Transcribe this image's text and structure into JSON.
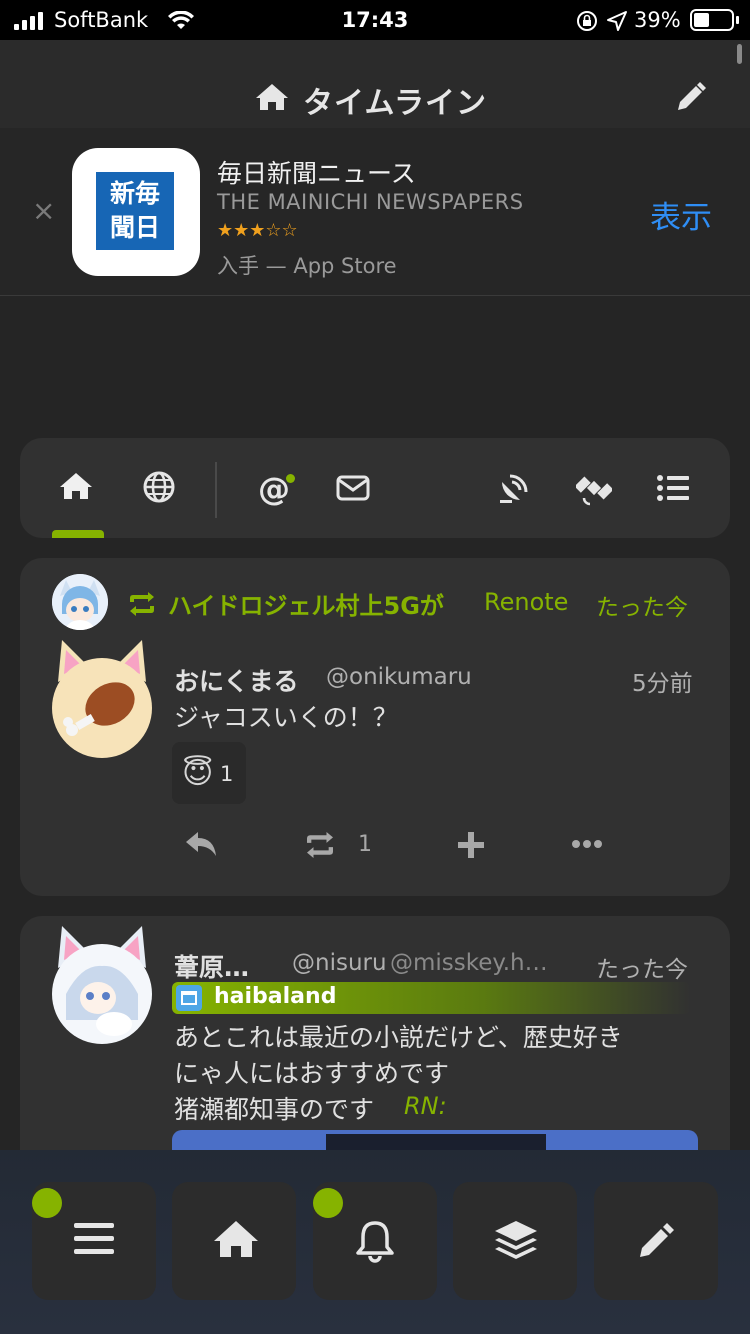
{
  "status_bar": {
    "carrier": "SoftBank",
    "time": "17:43",
    "battery": "39%"
  },
  "header": {
    "title": "タイムライン",
    "icon": "home-icon",
    "action_icon": "pencil-icon"
  },
  "app_banner": {
    "icon_text": "新毎\n聞日",
    "app_name": "毎日新聞ニュース",
    "publisher": "THE MAINICHI NEWSPAPERS",
    "rating": 3,
    "stars": "★★★☆☆",
    "source": "入手 — App Store",
    "view_label": "表示",
    "close_label": "×"
  },
  "timeline_tabs": [
    {
      "name": "home",
      "icon": "home-icon",
      "active": true
    },
    {
      "name": "global",
      "icon": "globe-icon"
    },
    {
      "name": "mentions",
      "icon": "at-icon",
      "has_indicator": true
    },
    {
      "name": "messages",
      "icon": "envelope-icon"
    },
    {
      "name": "antenna",
      "icon": "satellite-dish-icon"
    },
    {
      "name": "channels",
      "icon": "satellite-icon"
    },
    {
      "name": "lists",
      "icon": "list-icon"
    }
  ],
  "notes": [
    {
      "renote_by": "ハイドロジェル村上5Gが",
      "renote_label": "Renote",
      "renote_time": "たった今",
      "author": "おにくまる",
      "username": "@onikumaru",
      "time": "5分前",
      "text": "ジャコスいくの！？",
      "reaction_emoji": "😇",
      "reaction_count": "1",
      "renote_count": "1"
    },
    {
      "author": "葦原…",
      "username": "@nisuru",
      "host": "@misskey.h…",
      "time": "たった今",
      "instance": "haibaland",
      "text_lines": [
        "あとこれは最近の小説だけど、歴史好き",
        "にゃ人にはおすすめです",
        "猪瀬都知事のです"
      ],
      "rn_label": "RN:"
    }
  ],
  "bottom_nav": [
    {
      "name": "menu",
      "icon": "menu-icon",
      "has_indicator": true
    },
    {
      "name": "home",
      "icon": "home-icon"
    },
    {
      "name": "notifications",
      "icon": "bell-icon",
      "has_indicator": true
    },
    {
      "name": "widgets",
      "icon": "layers-icon"
    },
    {
      "name": "compose",
      "icon": "pencil-icon"
    }
  ],
  "colors": {
    "accent": "#86b300",
    "link": "#2f8ef5",
    "background": "#252525",
    "card": "#313131"
  }
}
